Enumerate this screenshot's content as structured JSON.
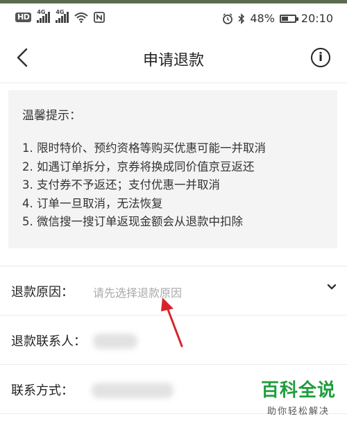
{
  "status_bar": {
    "hd_badge": "HD",
    "signal1_network": "4G",
    "signal2_network": "4G",
    "battery_percent": "48%",
    "battery_level": 0.48,
    "time": "20:10"
  },
  "navbar": {
    "title": "申请退款"
  },
  "tips": {
    "title": "温馨提示：",
    "items": [
      "1. 限时特价、预约资格等购买优惠可能一并取消",
      "2. 如遇订单拆分，京券将换成同价值京豆返还",
      "3. 支付券不予返还；支付优惠一并取消",
      "4. 订单一旦取消，无法恢复",
      "5. 微信搜一搜订单返现金额会从退款中扣除"
    ]
  },
  "form": {
    "reason_label": "退款原因：",
    "reason_placeholder": "请先选择退款原因",
    "contact_label": "退款联系人：",
    "phone_label": "联系方式："
  },
  "watermark": {
    "main": "百科全说",
    "sub": "助你轻松解决"
  },
  "colors": {
    "accent_top": "#5a6b4f",
    "watermark_green": "#1d9e3c",
    "arrow_red": "#d9232b",
    "tip_background": "#f4f4f4"
  }
}
